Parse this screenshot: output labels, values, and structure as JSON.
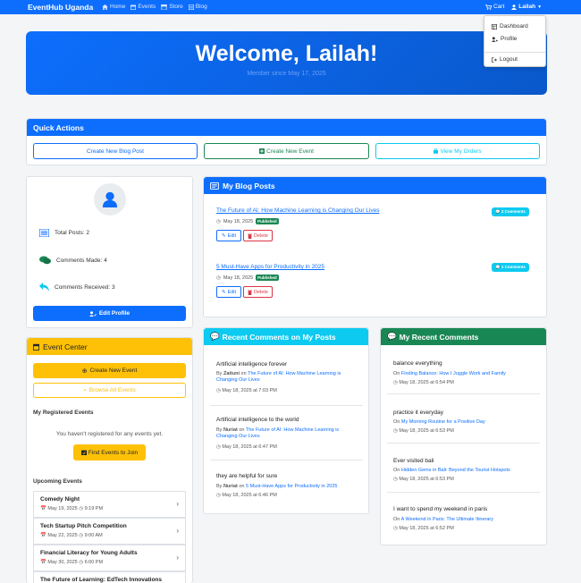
{
  "nav": {
    "brand": "EventHub Uganda",
    "links": [
      {
        "label": "Home",
        "icon": "home-icon"
      },
      {
        "label": "Events",
        "icon": "calendar-icon"
      },
      {
        "label": "Store",
        "icon": "store-icon"
      },
      {
        "label": "Blog",
        "icon": "blog-icon"
      }
    ],
    "cart_label": "Cart",
    "user_label": "Lailah",
    "dropdown": [
      {
        "label": "Dashboard",
        "icon": "dashboard-icon"
      },
      {
        "label": "Profile",
        "icon": "user-cog-icon"
      },
      {
        "label": "Logout",
        "icon": "logout-icon"
      }
    ]
  },
  "hero": {
    "title": "Welcome, Lailah!",
    "subtitle": "Member since May 17, 2025"
  },
  "quick_actions": {
    "title": "Quick Actions",
    "buttons": [
      {
        "label": "Create New Blog Post",
        "color": "#0d6efd"
      },
      {
        "label": "Create New Event",
        "color": "#198754"
      },
      {
        "label": "View My Orders",
        "color": "#0dcaf0"
      }
    ]
  },
  "profile": {
    "stats": [
      {
        "label": "Total Posts: 2",
        "icon": "list-icon"
      },
      {
        "label": "Comments Made: 4",
        "icon": "comments-icon"
      },
      {
        "label": "Comments Received: 3",
        "icon": "reply-icon"
      }
    ],
    "edit_label": "Edit Profile"
  },
  "blog_posts": {
    "title": "My Blog Posts",
    "edit_label": "Edit",
    "delete_label": "Delete",
    "items": [
      {
        "title": "The Future of AI: How Machine Learning is Changing Our Lives",
        "date": "May 18, 2025",
        "status": "Published",
        "comments": "2 Comments"
      },
      {
        "title": "5 Must-Have Apps for Productivity in 2025",
        "date": "May 18, 2025",
        "status": "Published",
        "comments": "1 Comments"
      }
    ]
  },
  "event_center": {
    "title": "Event Center",
    "create_label": "Create New Event",
    "browse_label": "Browse All Events",
    "registered_title": "My Registered Events",
    "empty_text": "You haven't registered for any events yet.",
    "find_label": "Find Events to Join",
    "upcoming_title": "Upcoming Events",
    "upcoming": [
      {
        "name": "Comedy Night",
        "date": "May 19, 2025",
        "time": "9:19 PM"
      },
      {
        "name": "Tech Startup Pitch Competition",
        "date": "May 22, 2025",
        "time": "9:00 AM"
      },
      {
        "name": "Financial Literacy for Young Adults",
        "date": "May 30, 2025",
        "time": "6:00 PM"
      },
      {
        "name": "The Future of Learning: EdTech Innovations",
        "date": "",
        "time": ""
      }
    ]
  },
  "recent_comments": {
    "title": "Recent Comments on My Posts",
    "by_prefix": "By",
    "on_word": "on",
    "items": [
      {
        "text": "Artificial intelligence forever",
        "author": "Zaituni",
        "post": "The Future of AI: How Machine Learning is Changing Our Lives",
        "date": "May 18, 2025 at 7:03 PM"
      },
      {
        "text": "Artificial intelligence to the world",
        "author": "Nuriat",
        "post": "The Future of AI: How Machine Learning is Changing Our Lives",
        "date": "May 18, 2025 at 6:47 PM"
      },
      {
        "text": "they are helpful for sure",
        "author": "Nuriat",
        "post": "5 Must-Have Apps for Productivity in 2025",
        "date": "May 18, 2025 at 6:46 PM"
      }
    ]
  },
  "my_comments": {
    "title": "My Recent Comments",
    "on_word": "On",
    "items": [
      {
        "text": "balance everything",
        "post": "Finding Balance: How I Juggle Work and Family",
        "date": "May 18, 2025 at 6:54 PM"
      },
      {
        "text": "practice it everyday",
        "post": "My Morning Routine for a Positive Day",
        "date": "May 18, 2025 at 6:53 PM"
      },
      {
        "text": "Ever visited bali",
        "post": "Hidden Gems in Bali: Beyond the Tourist Hotspots",
        "date": "May 18, 2025 at 6:53 PM"
      },
      {
        "text": "I want to spend my weekend in paris",
        "post": "A Weekend in Paris: The Ultimate Itinerary",
        "date": "May 18, 2025 at 6:52 PM"
      }
    ]
  }
}
